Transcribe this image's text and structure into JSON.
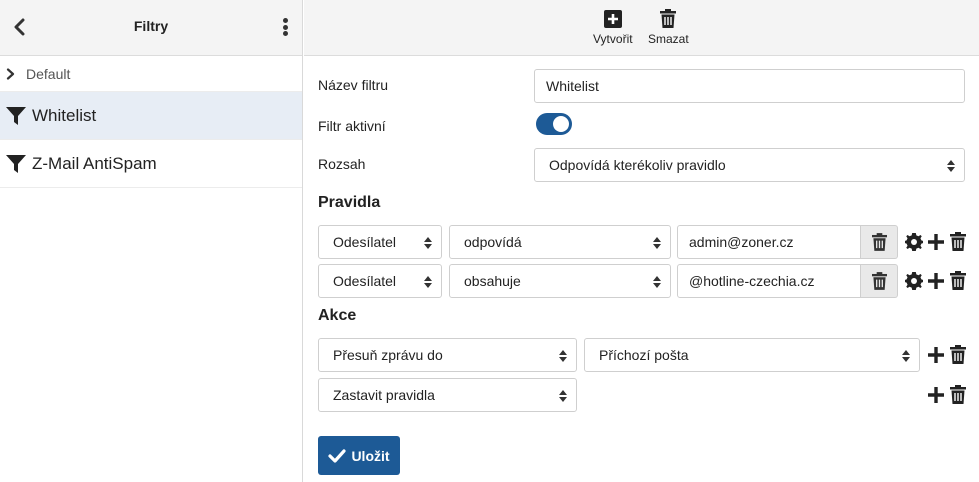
{
  "left": {
    "title": "Filtry",
    "group_label": "Default",
    "filters": [
      {
        "label": "Whitelist"
      },
      {
        "label": "Z-Mail AntiSpam"
      }
    ]
  },
  "toolbar": {
    "create_label": "Vytvořit",
    "delete_label": "Smazat"
  },
  "form": {
    "name_label": "Název filtru",
    "name_value": "Whitelist",
    "active_label": "Filtr aktivní",
    "active": true,
    "scope_label": "Rozsah",
    "scope_value": "Odpovídá kterékoliv pravidlo",
    "rules_heading": "Pravidla",
    "rules": [
      {
        "field": "Odesílatel",
        "operator": "odpovídá",
        "value": "admin@zoner.cz"
      },
      {
        "field": "Odesílatel",
        "operator": "obsahuje",
        "value": "@hotline-czechia.cz"
      }
    ],
    "actions_heading": "Akce",
    "actions": [
      {
        "action": "Přesuň zprávu do",
        "target": "Příchozí pošta"
      },
      {
        "action": "Zastavit pravidla"
      }
    ],
    "save_label": "Uložit"
  },
  "colors": {
    "accent": "#1d5a96",
    "active_row": "#e7edf5",
    "header_bg": "#f4f4f4"
  }
}
